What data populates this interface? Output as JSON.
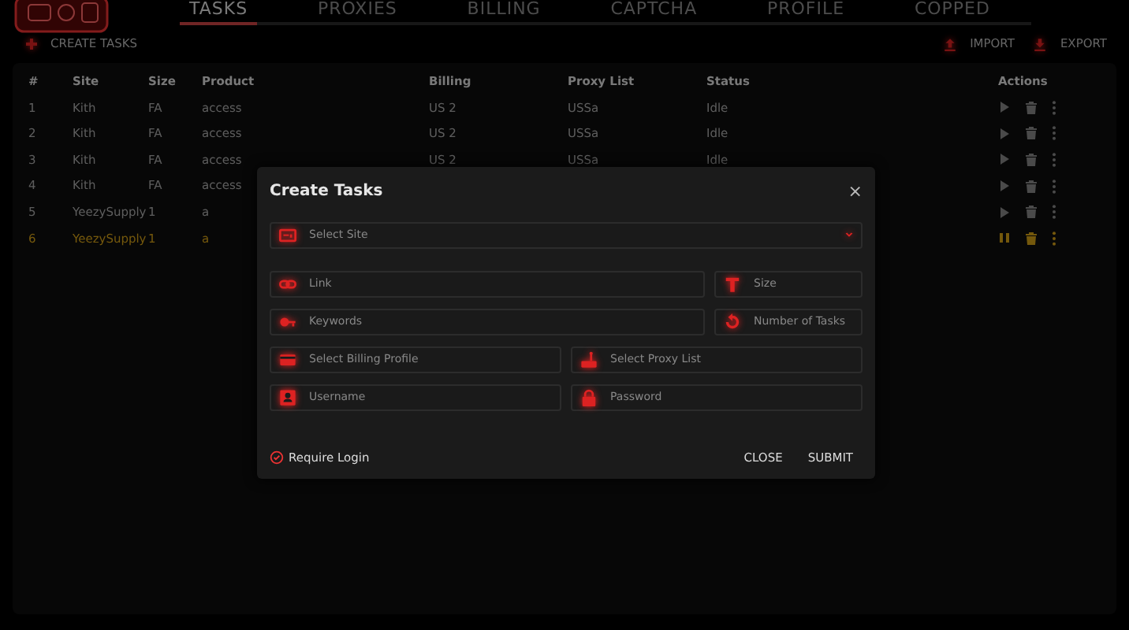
{
  "nav": {
    "tabs": [
      {
        "label": "TASKS",
        "selected": true
      },
      {
        "label": "PROXIES",
        "selected": false
      },
      {
        "label": "BILLING",
        "selected": false
      },
      {
        "label": "CAPTCHA",
        "selected": false
      },
      {
        "label": "PROFILE",
        "selected": false
      },
      {
        "label": "COPPED",
        "selected": false
      }
    ]
  },
  "toolbar": {
    "create": "CREATE TASKS",
    "import": "IMPORT",
    "export": "EXPORT"
  },
  "table": {
    "columns": [
      "#",
      "Site",
      "Size",
      "Product",
      "Billing",
      "Proxy List",
      "Status",
      "Actions"
    ],
    "rows": [
      {
        "cells": [
          "1",
          "Kith",
          "FA",
          "access",
          "US 2",
          "USSa",
          "Idle"
        ],
        "running": false
      },
      {
        "cells": [
          "2",
          "Kith",
          "FA",
          "access",
          "US 2",
          "USSa",
          "Idle"
        ],
        "running": false
      },
      {
        "cells": [
          "3",
          "Kith",
          "FA",
          "access",
          "US 2",
          "USSa",
          "Idle"
        ],
        "running": false
      },
      {
        "cells": [
          "4",
          "Kith",
          "FA",
          "access"
        ],
        "running": false
      },
      {
        "cells": [
          "5",
          "YeezySupply",
          "1",
          "a"
        ],
        "running": false
      },
      {
        "cells": [
          "6",
          "YeezySupply",
          "1",
          "a"
        ],
        "running": true
      }
    ]
  },
  "modal": {
    "title": "Create Tasks",
    "close_icon": "×",
    "fields": [
      {
        "kind": "select",
        "placeholder": "Select Site"
      },
      {
        "kind": "input",
        "placeholder": "Link"
      },
      {
        "kind": "input",
        "placeholder": "Size"
      },
      {
        "kind": "input",
        "placeholder": "Keywords"
      },
      {
        "kind": "input",
        "placeholder": "Number of Tasks"
      },
      {
        "kind": "input",
        "placeholder": "Select Billing Profile"
      },
      {
        "kind": "input",
        "placeholder": "Select Proxy List"
      },
      {
        "kind": "input",
        "placeholder": "Username"
      },
      {
        "kind": "input",
        "placeholder": "Password"
      }
    ],
    "require_login": {
      "label": "Require Login",
      "checked": true
    },
    "buttons": [
      "CLOSE",
      "SUBMIT"
    ]
  }
}
